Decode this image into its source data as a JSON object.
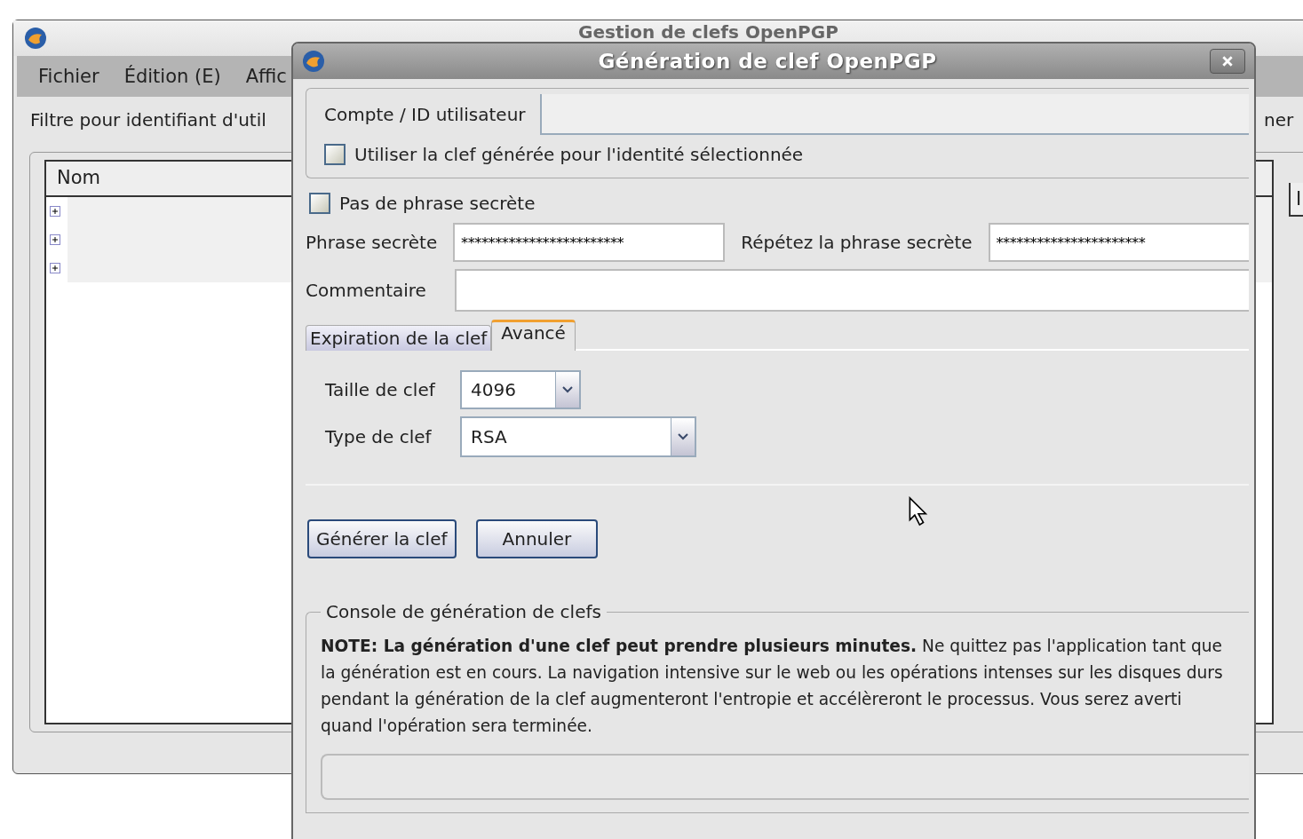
{
  "main_window": {
    "title": "Gestion de clefs OpenPGP",
    "menu": [
      "Fichier",
      "Édition (E)",
      "Affic"
    ],
    "filter_label": "Filtre pour identifiant d'util",
    "filter_right": "ner",
    "columns": [
      "Nom",
      "I"
    ],
    "rows": [
      {
        "expanded": false
      },
      {
        "expanded": false
      },
      {
        "expanded": false
      }
    ]
  },
  "dialog": {
    "title": "Génération de clef OpenPGP",
    "account_label": "Compte / ID utilisateur",
    "use_for_identity": {
      "label": "Utiliser la clef générée pour l'identité sélectionnée",
      "checked": false
    },
    "no_passphrase": {
      "label": "Pas de phrase secrète",
      "checked": false
    },
    "passphrase_label": "Phrase secrète",
    "passphrase_value": "************************",
    "repeat_label": "Répétez la phrase secrète",
    "repeat_value": "**********************",
    "comment_label": "Commentaire",
    "tabs": [
      {
        "label": "Expiration de la clef",
        "selected": false
      },
      {
        "label": "Avancé",
        "selected": true
      }
    ],
    "key_size_label": "Taille de clef",
    "key_size": "4096",
    "key_type_label": "Type de clef",
    "key_type": "RSA",
    "buttons": [
      "Générer la clef",
      "Annuler"
    ],
    "console_title": "Console de génération de clefs",
    "note": "**NOTE: La génération d'une clef peut prendre plusieurs minutes.** Ne quittez pas l'application tant que la génération est en cours. La navigation intensive sur le web ou les opérations intenses sur les disques durs pendant la génération de la clef augmenteront l'entropie et accélèreront le processus. Vous serez averti quand l'opération sera terminée."
  }
}
